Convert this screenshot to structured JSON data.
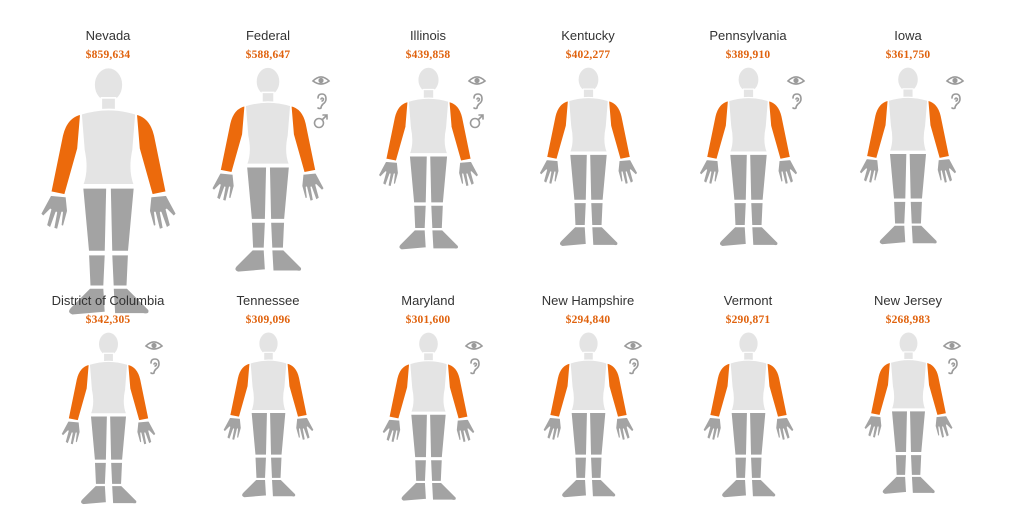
{
  "colors": {
    "arm": "#ec6a0c",
    "limb": "#a3a3a3",
    "torso": "#e4e4e4",
    "amount": "#e0620d",
    "name": "#333333",
    "badge": "#9a9a9a"
  },
  "entries": [
    {
      "name": "Nevada",
      "amount": "$859,634",
      "scale": 1.45,
      "badges": []
    },
    {
      "name": "Federal",
      "amount": "$588,647",
      "scale": 1.2,
      "badges": [
        "eye-icon",
        "ear-icon",
        "male-icon"
      ]
    },
    {
      "name": "Illinois",
      "amount": "$439,858",
      "scale": 1.07,
      "badges": [
        "eye-icon",
        "ear-icon",
        "male-icon"
      ]
    },
    {
      "name": "Kentucky",
      "amount": "$402,277",
      "scale": 1.05,
      "badges": []
    },
    {
      "name": "Pennsylvania",
      "amount": "$389,910",
      "scale": 1.05,
      "badges": [
        "eye-icon",
        "ear-icon"
      ]
    },
    {
      "name": "Iowa",
      "amount": "$361,750",
      "scale": 1.04,
      "badges": [
        "eye-icon",
        "ear-icon"
      ]
    },
    {
      "name": "District of Columbia",
      "amount": "$342,305",
      "scale": 1.01,
      "badges": [
        "eye-icon",
        "ear-icon"
      ]
    },
    {
      "name": "Tennessee",
      "amount": "$309,096",
      "scale": 0.97,
      "badges": []
    },
    {
      "name": "Maryland",
      "amount": "$301,600",
      "scale": 0.99,
      "badges": [
        "eye-icon",
        "ear-icon"
      ]
    },
    {
      "name": "New Hampshire",
      "amount": "$294,840",
      "scale": 0.97,
      "badges": [
        "eye-icon",
        "ear-icon"
      ]
    },
    {
      "name": "Vermont",
      "amount": "$290,871",
      "scale": 0.97,
      "badges": []
    },
    {
      "name": "New Jersey",
      "amount": "$268,983",
      "scale": 0.95,
      "badges": [
        "eye-icon",
        "ear-icon"
      ]
    }
  ]
}
